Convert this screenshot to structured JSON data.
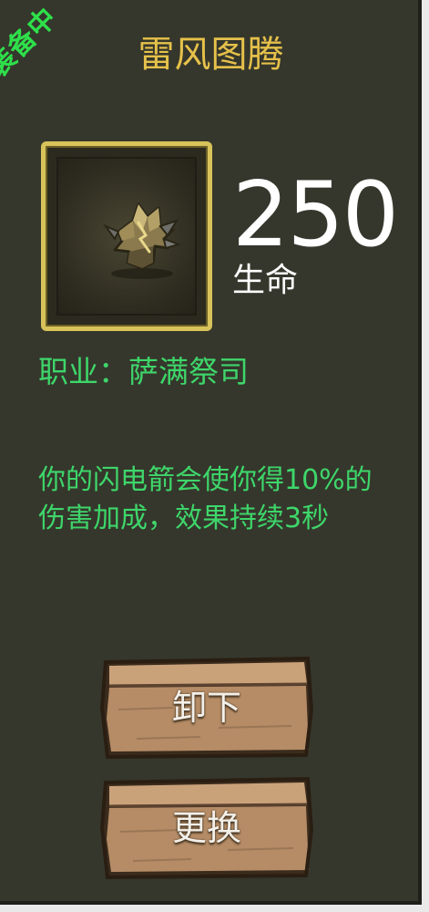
{
  "item": {
    "badge": "装备中",
    "name": "雷风图腾",
    "stat_value": "250",
    "stat_name": "生命",
    "class_line": "职业：萨满祭司",
    "description": "你的闪电箭会使你得10%的伤害加成，效果持续3秒",
    "icon": "totem-icon"
  },
  "buttons": {
    "unequip": "卸下",
    "replace": "更换"
  },
  "colors": {
    "panel_bg": "#35372c",
    "title": "#e6c14a",
    "green_text": "#3ed66a",
    "frame_gold": "#d8c25a",
    "wood": "#b9906a"
  }
}
